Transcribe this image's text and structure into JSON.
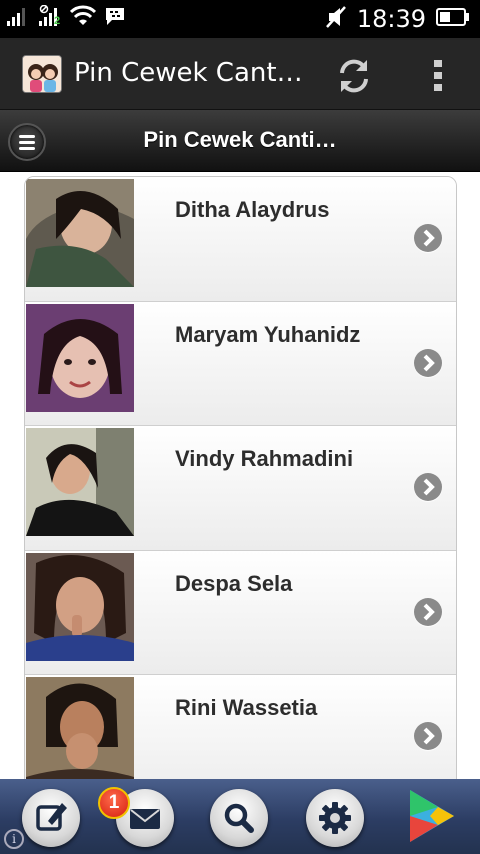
{
  "status_bar": {
    "time": "18:39",
    "sim2_label": "2",
    "icons": [
      "signal-icon",
      "signal-icon",
      "wifi-icon",
      "bbm-icon",
      "mute-icon",
      "battery-icon"
    ]
  },
  "action_bar": {
    "title": "Pin Cewek Cant…",
    "refresh_icon": "refresh-icon",
    "overflow_icon": "more-vert-icon"
  },
  "header": {
    "title": "Pin Cewek Canti…",
    "menu_icon": "menu-icon"
  },
  "list": {
    "items": [
      {
        "name": "Ditha Alaydrus"
      },
      {
        "name": "Maryam Yuhanidz"
      },
      {
        "name": "Vindy Rahmadini"
      },
      {
        "name": "Despa Sela"
      },
      {
        "name": "Rini Wassetia"
      }
    ]
  },
  "toolbar": {
    "buttons": [
      "compose-icon",
      "mail-icon",
      "search-icon",
      "settings-icon",
      "play-store-icon"
    ],
    "mail_badge": "1",
    "info_icon": "i"
  }
}
